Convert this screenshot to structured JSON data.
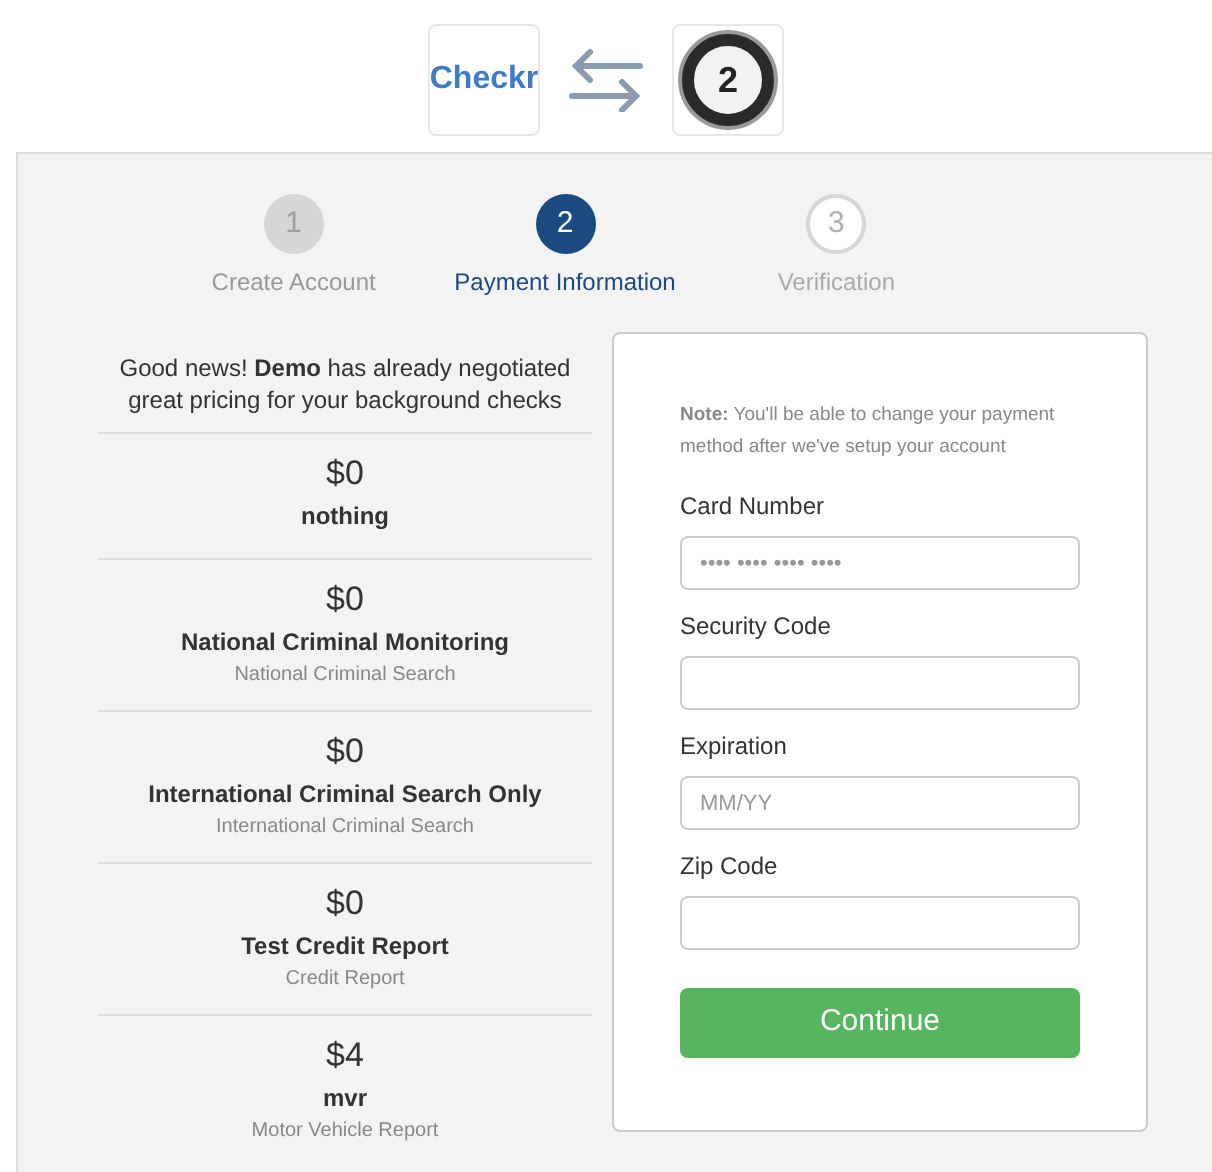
{
  "header": {
    "logos": [
      {
        "kind": "checkr",
        "text": "Checkr"
      },
      {
        "kind": "oauth",
        "text": "2"
      }
    ]
  },
  "steps": [
    {
      "number": "1",
      "label": "Create Account",
      "kind": "done"
    },
    {
      "number": "2",
      "label": "Payment Information",
      "kind": "current"
    },
    {
      "number": "3",
      "label": "Verification",
      "kind": "upcoming"
    }
  ],
  "pricing": {
    "intro": "Good news! **Demo** has already negotiated great pricing for your background checks",
    "packages": [
      {
        "price": "$0",
        "name": "nothing"
      },
      {
        "price": "$0",
        "name": "National Criminal Monitoring",
        "description": "National Criminal Search"
      },
      {
        "price": "$0",
        "name": "International Criminal Search Only",
        "description": "International Criminal Search"
      },
      {
        "price": "$0",
        "name": "Test Credit Report",
        "description": "Credit Report"
      },
      {
        "price": "$4",
        "name": "mvr",
        "description": "Motor Vehicle Report"
      }
    ]
  },
  "form": {
    "note": "**Note:** You'll be able to change your payment method after we've setup your account",
    "fields": [
      {
        "label": "Card Number",
        "placeholder": "•••• •••• •••• ••••"
      },
      {
        "label": "Security Code"
      },
      {
        "label": "Expiration",
        "placeholder": "MM/YY"
      },
      {
        "label": "Zip Code"
      }
    ],
    "button": "Continue"
  }
}
